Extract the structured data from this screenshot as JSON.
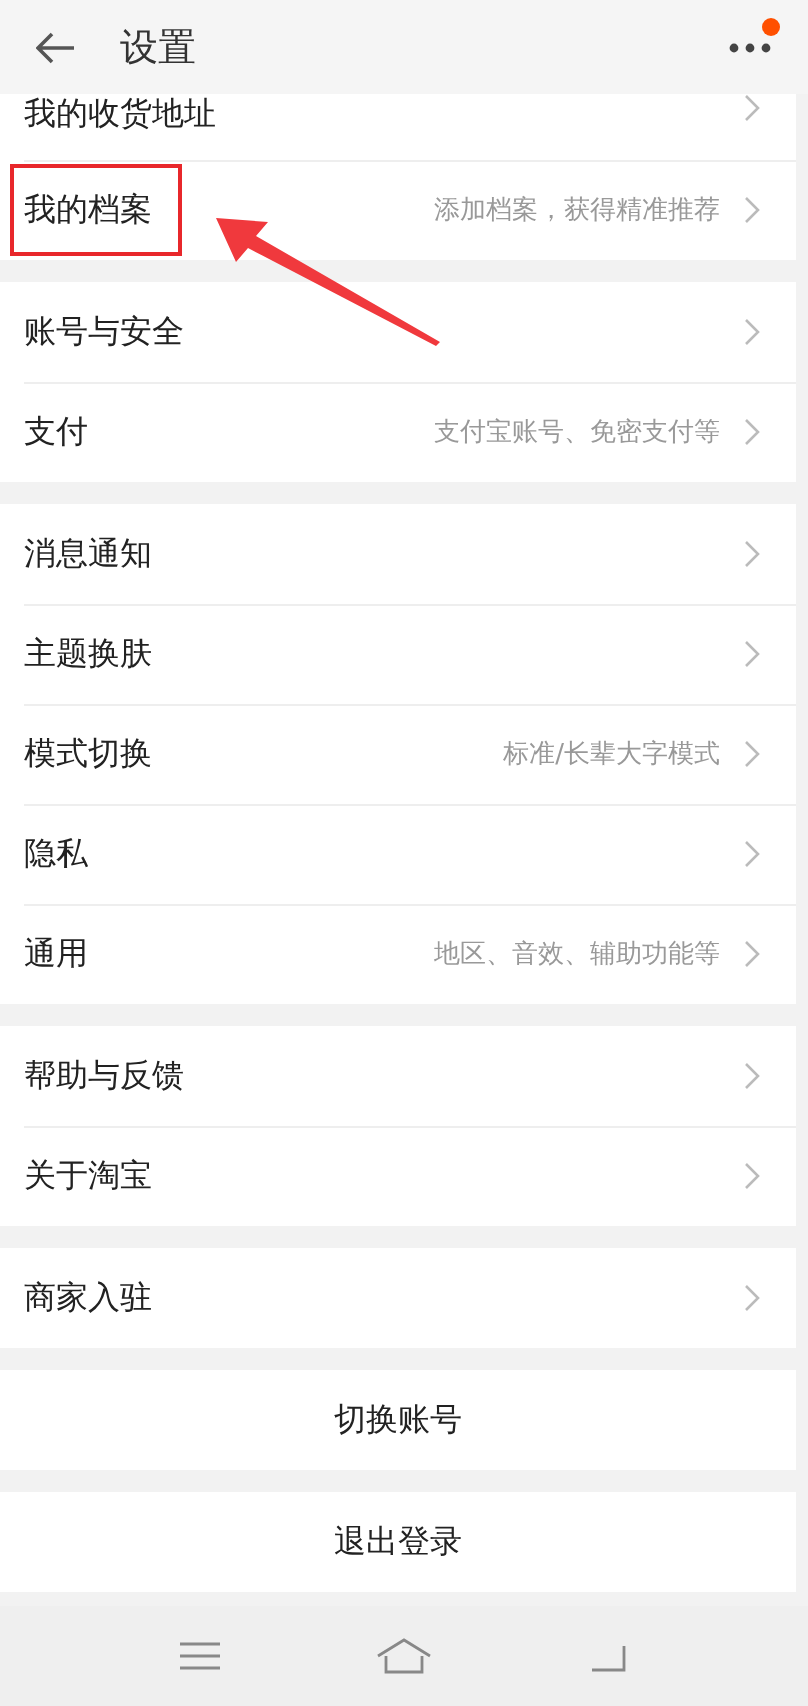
{
  "header": {
    "title": "设置",
    "menu_badge": true
  },
  "groups": [
    {
      "rows": [
        {
          "label": "我的收货地址",
          "partial": true
        },
        {
          "label": "我的档案",
          "hint": "添加档案，获得精准推荐",
          "highlighted": true
        }
      ]
    },
    {
      "rows": [
        {
          "label": "账号与安全"
        },
        {
          "label": "支付",
          "hint": "支付宝账号、免密支付等"
        }
      ]
    },
    {
      "rows": [
        {
          "label": "消息通知"
        },
        {
          "label": "主题换肤"
        },
        {
          "label": "模式切换",
          "hint": "标准/长辈大字模式"
        },
        {
          "label": "隐私"
        },
        {
          "label": "通用",
          "hint": "地区、音效、辅助功能等"
        }
      ]
    },
    {
      "rows": [
        {
          "label": "帮助与反馈"
        },
        {
          "label": "关于淘宝"
        }
      ]
    },
    {
      "rows": [
        {
          "label": "商家入驻"
        }
      ]
    }
  ],
  "buttons": [
    "切换账号",
    "退出登录"
  ]
}
